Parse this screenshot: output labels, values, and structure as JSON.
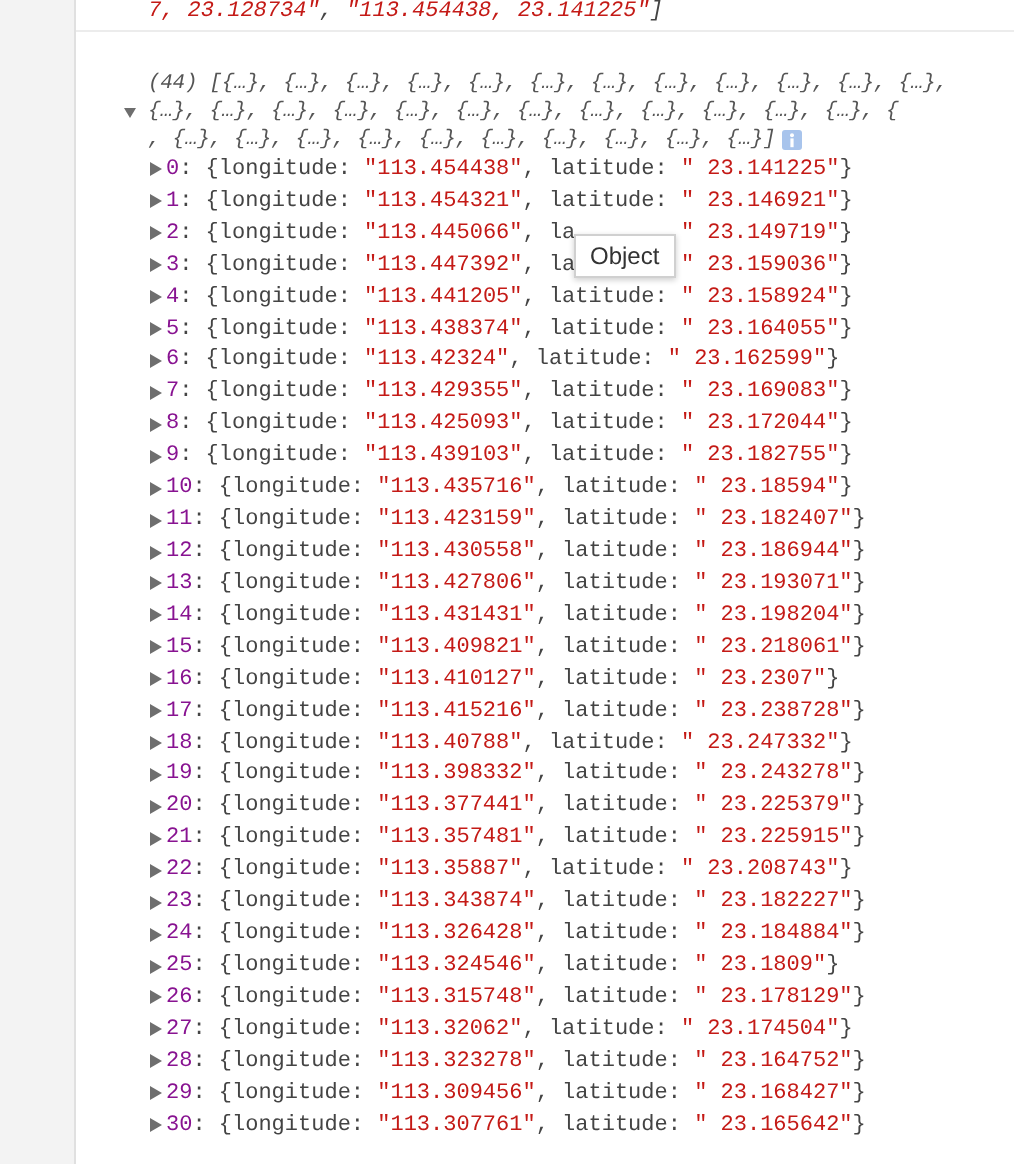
{
  "previous_output": {
    "parts": [
      {
        "kind": "string",
        "text": "7, 23.128734\""
      },
      {
        "kind": "punct",
        "text": ", "
      },
      {
        "kind": "string",
        "text": "\"113.454438, 23.141225\""
      },
      {
        "kind": "punct",
        "text": "]"
      }
    ]
  },
  "array": {
    "expanded": true,
    "summary_lines": [
      "(44) [{…}, {…}, {…}, {…}, {…}, {…}, {…}, {…}, {…}, {…}, {…}, {…},",
      "{…}, {…}, {…}, {…}, {…}, {…}, {…}, {…}, {…}, {…}, {…}, {…}, {",
      ", {…}, {…}, {…}, {…}, {…}, {…}, {…}, {…}, {…}, {…}]"
    ],
    "rows": [
      {
        "index": "0",
        "expanded": false,
        "head": ": {longitude: ",
        "lon": "\"113.454438\"",
        "mid": ", latitude: ",
        "lat": "\" 23.141225\"",
        "tail": "}"
      },
      {
        "index": "1",
        "expanded": false,
        "head": ": {longitude: ",
        "lon": "\"113.454321\"",
        "mid": ", latitude: ",
        "lat": "\" 23.146921\"",
        "tail": "}"
      },
      {
        "index": "2",
        "expanded": false,
        "covered": true,
        "head": ": {longitude: ",
        "lon": "\"113.445066\"",
        "mid": ", la",
        "lat": "\" 23.149719\"",
        "tail": "}"
      },
      {
        "index": "3",
        "expanded": false,
        "covered": true,
        "head": ": {longitude: ",
        "lon": "\"113.447392\"",
        "mid": ", la",
        "lat": "\" 23.159036\"",
        "tail": "}"
      },
      {
        "index": "4",
        "expanded": false,
        "head": ": {longitude: ",
        "lon": "\"113.441205\"",
        "mid": ", latitude: ",
        "lat": "\" 23.158924\"",
        "tail": "}"
      },
      {
        "index": "5",
        "expanded": false,
        "head": ": {longitude: ",
        "lon": "\"113.438374\"",
        "mid": ", latitude: ",
        "lat": "\" 23.164055\"",
        "tail": "}"
      },
      {
        "index": "6",
        "expanded": false,
        "head": ": {longitude: ",
        "lon": "\"113.42324\"",
        "mid": ", latitude: ",
        "lat": "\" 23.162599\"",
        "tail": "}"
      },
      {
        "index": "7",
        "expanded": false,
        "head": ": {longitude: ",
        "lon": "\"113.429355\"",
        "mid": ", latitude: ",
        "lat": "\" 23.169083\"",
        "tail": "}"
      },
      {
        "index": "8",
        "expanded": false,
        "head": ": {longitude: ",
        "lon": "\"113.425093\"",
        "mid": ", latitude: ",
        "lat": "\" 23.172044\"",
        "tail": "}"
      },
      {
        "index": "9",
        "expanded": false,
        "head": ": {longitude: ",
        "lon": "\"113.439103\"",
        "mid": ", latitude: ",
        "lat": "\" 23.182755\"",
        "tail": "}"
      },
      {
        "index": "10",
        "expanded": false,
        "head": ": {longitude: ",
        "lon": "\"113.435716\"",
        "mid": ", latitude: ",
        "lat": "\" 23.18594\"",
        "tail": "}"
      },
      {
        "index": "11",
        "expanded": false,
        "head": ": {longitude: ",
        "lon": "\"113.423159\"",
        "mid": ", latitude: ",
        "lat": "\" 23.182407\"",
        "tail": "}"
      },
      {
        "index": "12",
        "expanded": false,
        "head": ": {longitude: ",
        "lon": "\"113.430558\"",
        "mid": ", latitude: ",
        "lat": "\" 23.186944\"",
        "tail": "}"
      },
      {
        "index": "13",
        "expanded": false,
        "head": ": {longitude: ",
        "lon": "\"113.427806\"",
        "mid": ", latitude: ",
        "lat": "\" 23.193071\"",
        "tail": "}"
      },
      {
        "index": "14",
        "expanded": false,
        "head": ": {longitude: ",
        "lon": "\"113.431431\"",
        "mid": ", latitude: ",
        "lat": "\" 23.198204\"",
        "tail": "}"
      },
      {
        "index": "15",
        "expanded": false,
        "head": ": {longitude: ",
        "lon": "\"113.409821\"",
        "mid": ", latitude: ",
        "lat": "\" 23.218061\"",
        "tail": "}"
      },
      {
        "index": "16",
        "expanded": false,
        "head": ": {longitude: ",
        "lon": "\"113.410127\"",
        "mid": ", latitude: ",
        "lat": "\" 23.2307\"",
        "tail": "}"
      },
      {
        "index": "17",
        "expanded": false,
        "head": ": {longitude: ",
        "lon": "\"113.415216\"",
        "mid": ", latitude: ",
        "lat": "\" 23.238728\"",
        "tail": "}"
      },
      {
        "index": "18",
        "expanded": false,
        "head": ": {longitude: ",
        "lon": "\"113.40788\"",
        "mid": ", latitude: ",
        "lat": "\" 23.247332\"",
        "tail": "}"
      },
      {
        "index": "19",
        "expanded": false,
        "head": ": {longitude: ",
        "lon": "\"113.398332\"",
        "mid": ", latitude: ",
        "lat": "\" 23.243278\"",
        "tail": "}"
      },
      {
        "index": "20",
        "expanded": false,
        "head": ": {longitude: ",
        "lon": "\"113.377441\"",
        "mid": ", latitude: ",
        "lat": "\" 23.225379\"",
        "tail": "}"
      },
      {
        "index": "21",
        "expanded": false,
        "head": ": {longitude: ",
        "lon": "\"113.357481\"",
        "mid": ", latitude: ",
        "lat": "\" 23.225915\"",
        "tail": "}"
      },
      {
        "index": "22",
        "expanded": false,
        "head": ": {longitude: ",
        "lon": "\"113.35887\"",
        "mid": ", latitude: ",
        "lat": "\" 23.208743\"",
        "tail": "}"
      },
      {
        "index": "23",
        "expanded": false,
        "head": ": {longitude: ",
        "lon": "\"113.343874\"",
        "mid": ", latitude: ",
        "lat": "\" 23.182227\"",
        "tail": "}"
      },
      {
        "index": "24",
        "expanded": false,
        "head": ": {longitude: ",
        "lon": "\"113.326428\"",
        "mid": ", latitude: ",
        "lat": "\" 23.184884\"",
        "tail": "}"
      },
      {
        "index": "25",
        "expanded": false,
        "head": ": {longitude: ",
        "lon": "\"113.324546\"",
        "mid": ", latitude: ",
        "lat": "\" 23.1809\"",
        "tail": "}"
      },
      {
        "index": "26",
        "expanded": false,
        "head": ": {longitude: ",
        "lon": "\"113.315748\"",
        "mid": ", latitude: ",
        "lat": "\" 23.178129\"",
        "tail": "}"
      },
      {
        "index": "27",
        "expanded": false,
        "head": ": {longitude: ",
        "lon": "\"113.32062\"",
        "mid": ", latitude: ",
        "lat": "\" 23.174504\"",
        "tail": "}"
      },
      {
        "index": "28",
        "expanded": false,
        "head": ": {longitude: ",
        "lon": "\"113.323278\"",
        "mid": ", latitude: ",
        "lat": "\" 23.164752\"",
        "tail": "}"
      },
      {
        "index": "29",
        "expanded": false,
        "head": ": {longitude: ",
        "lon": "\"113.309456\"",
        "mid": ", latitude: ",
        "lat": "\" 23.168427\"",
        "tail": "}"
      },
      {
        "index": "30",
        "expanded": false,
        "head": ": {longitude: ",
        "lon": "\"113.307761\"",
        "mid": ", latitude: ",
        "lat": "\" 23.165642\"",
        "tail": "}"
      }
    ]
  },
  "tooltip": {
    "text": "Object"
  }
}
